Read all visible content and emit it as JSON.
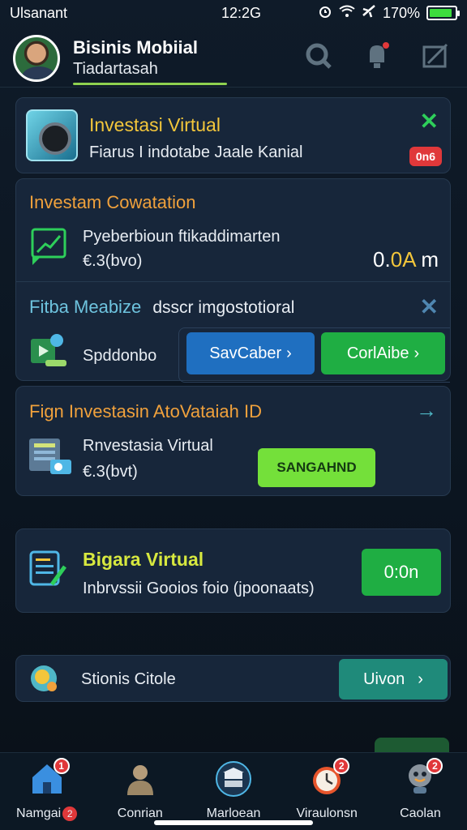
{
  "status_bar": {
    "carrier": "Ulsanant",
    "time": "12:2G",
    "battery_text": "170%",
    "battery_level": 0.9
  },
  "header": {
    "title": "Bisinis Mobiial",
    "subtitle": "Tiadartasah"
  },
  "card_1": {
    "title": "Investasi Virtual",
    "description": "Fiarus I indotabe Jaale Kanial",
    "badge": "0n6"
  },
  "card_2": {
    "section_title": "Investam Cowatation",
    "item_title": "Pyeberbioun ftikaddimarten",
    "item_value_sub": "€.3(bvo)",
    "value_prefix": "0.",
    "value_highlight": "0A",
    "value_suffix": " m",
    "subpanel_title": "Fitba Meabize",
    "subpanel_desc": "dsscr imgostotioral",
    "subpanel_label": "Spddonbo",
    "btn_blue": "SavCaber",
    "btn_green": "CorlAibe"
  },
  "card_3": {
    "title": "Fign Investasin AtoVataiah ID",
    "item_title": "Rnvestasia Virtual",
    "item_sub": "€.3(bvt)",
    "btn": "SANGAHND"
  },
  "card_4": {
    "title": "Bigara Virtual",
    "description": "Inbrvssii Gooios foio (jpoonaats)",
    "btn": "0:0n"
  },
  "card_5": {
    "label": "Stionis Citole",
    "btn": "Uivon"
  },
  "bottom_nav": {
    "items": [
      {
        "label": "Namgai",
        "badge": "1",
        "label_badge": "2"
      },
      {
        "label": "Conrian",
        "badge": ""
      },
      {
        "label": "Marloean",
        "badge": ""
      },
      {
        "label": "Viraulonsn",
        "badge": "2"
      },
      {
        "label": "Caolan",
        "badge": "2"
      }
    ]
  },
  "colors": {
    "accent_green": "#1fae43",
    "accent_blue": "#1f6fc0",
    "accent_yellow": "#f3c63b",
    "badge_red": "#e0383a"
  }
}
